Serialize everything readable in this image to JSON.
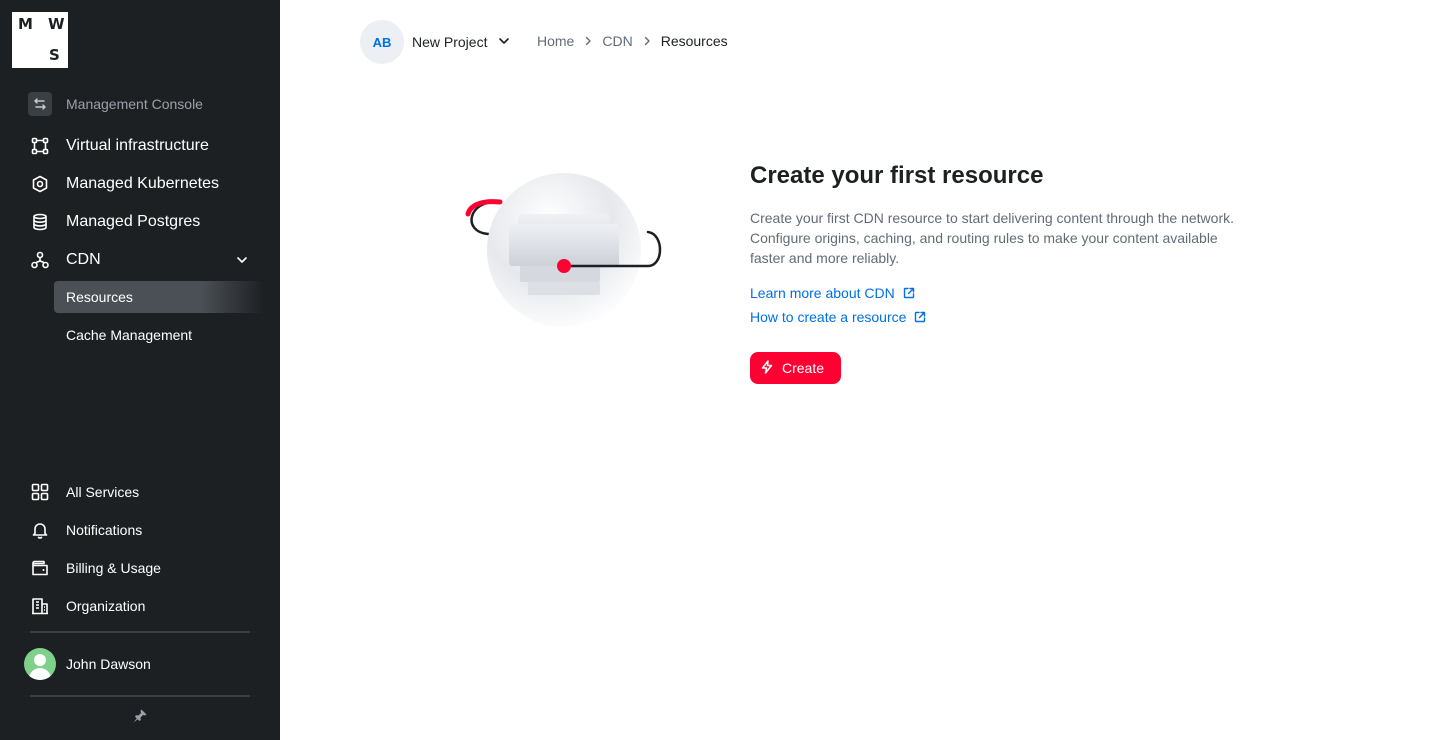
{
  "logo": {
    "letters": [
      "M",
      "W",
      "S"
    ]
  },
  "sidebar": {
    "console_label": "Management Console",
    "items": [
      {
        "label": "Virtual infrastructure",
        "icon": "vm-icon"
      },
      {
        "label": "Managed Kubernetes",
        "icon": "kubernetes-icon"
      },
      {
        "label": "Managed Postgres",
        "icon": "database-icon"
      },
      {
        "label": "CDN",
        "icon": "cdn-icon",
        "expanded": true
      }
    ],
    "cdn_sub_items": [
      {
        "label": "Resources",
        "active": true
      },
      {
        "label": "Cache Management",
        "active": false
      }
    ],
    "bottom_items": [
      {
        "label": "All Services",
        "icon": "grid-icon"
      },
      {
        "label": "Notifications",
        "icon": "bell-icon"
      },
      {
        "label": "Billing & Usage",
        "icon": "wallet-icon"
      },
      {
        "label": "Organization",
        "icon": "building-icon"
      }
    ],
    "user": {
      "name": "John Dawson"
    }
  },
  "header": {
    "project": {
      "initials": "AB",
      "name": "New Project"
    },
    "breadcrumb": [
      "Home",
      "CDN",
      "Resources"
    ]
  },
  "empty_state": {
    "title": "Create your first resource",
    "description": "Create your first CDN resource to start delivering content through the network. Configure origins, caching, and routing rules to make your content available faster and more reliably.",
    "links": [
      "Learn more about CDN",
      "How to create a resource"
    ],
    "create_label": "Create"
  },
  "colors": {
    "sidebar_bg": "#1d2023",
    "accent": "#ff0032",
    "link": "#0070e5",
    "text_secondary": "#626c77"
  }
}
